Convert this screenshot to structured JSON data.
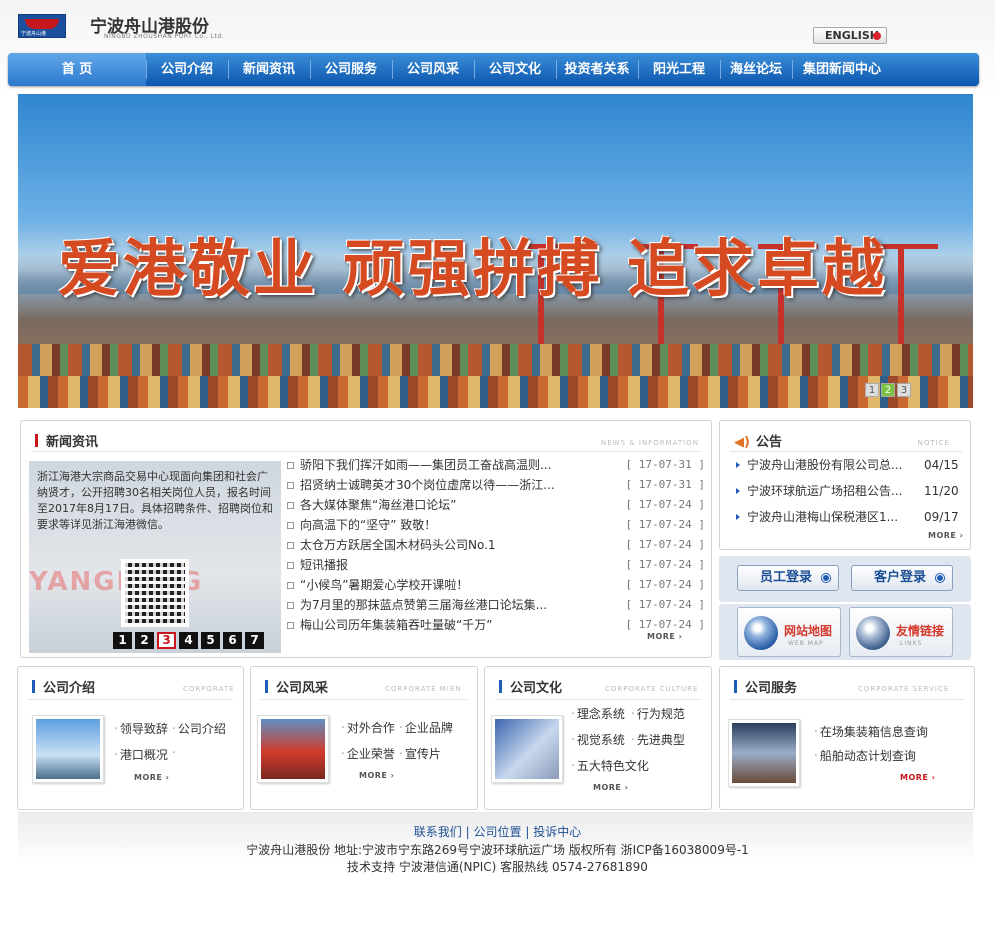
{
  "header": {
    "brand": "宁波舟山港股份",
    "brand_en": "NINGBO ZHOUSHAN PORT Co., Ltd.",
    "logo_text": "宁波舟山港",
    "english_label": "ENGLISH"
  },
  "nav": {
    "items": [
      "首 页",
      "公司介绍",
      "新闻资讯",
      "公司服务",
      "公司风采",
      "公司文化",
      "投资者关系",
      "阳光工程",
      "海丝论坛",
      "集团新闻中心"
    ]
  },
  "banner": {
    "slogan": "爱港敬业 顽强拼搏 追求卓越",
    "slides": [
      "1",
      "2",
      "3"
    ],
    "active_slide": 2
  },
  "news": {
    "title": "新闻资讯",
    "title_en": "NEWS & INFORMATION",
    "image_caption": "浙江海港大宗商品交易中心现面向集团和社会广纳贤才，公开招聘30名相关岗位人员，报名时间至2017年8月17日。具体招聘条件、招聘岗位和要求等详见浙江海港微信。",
    "image_watermark": "YANGMING",
    "pager": [
      "1",
      "2",
      "3",
      "4",
      "5",
      "6",
      "7"
    ],
    "active_page": 3,
    "items": [
      {
        "title": "骄阳下我们挥汗如雨——集团员工奋战高温则...",
        "date": "[ 17-07-31 ]"
      },
      {
        "title": "招贤纳士诚聘英才30个岗位虚席以待——浙江...",
        "date": "[ 17-07-31 ]"
      },
      {
        "title": "各大媒体聚焦“海丝港口论坛”",
        "date": "[ 17-07-24 ]"
      },
      {
        "title": "向高温下的“坚守” 致敬！",
        "date": "[ 17-07-24 ]"
      },
      {
        "title": "太仓万方跃居全国木材码头公司No.1",
        "date": "[ 17-07-24 ]"
      },
      {
        "title": "短讯播报",
        "date": "[ 17-07-24 ]"
      },
      {
        "title": "“小候鸟”暑期爱心学校开课啦！",
        "date": "[ 17-07-24 ]"
      },
      {
        "title": "为7月里的那抹蓝点赞第三届海丝港口论坛集...",
        "date": "[ 17-07-24 ]"
      },
      {
        "title": "梅山公司历年集装箱吞吐量破“千万”",
        "date": "[ 17-07-24 ]"
      }
    ],
    "more": "MORE"
  },
  "notice": {
    "title": "公告",
    "title_en": "NOTICE",
    "items": [
      {
        "title": "宁波舟山港股份有限公司总...",
        "date": "04/15"
      },
      {
        "title": "宁波环球航运广场招租公告...",
        "date": "11/20"
      },
      {
        "title": "宁波舟山港梅山保税港区1...",
        "date": "09/17"
      }
    ],
    "more": "MORE"
  },
  "login": {
    "staff": "员工登录",
    "client": "客户登录"
  },
  "links": {
    "sitemap": "网站地图",
    "sitemap_en": "WEB MAP",
    "friend": "友情链接",
    "friend_en": "LINKS"
  },
  "bottom": {
    "intro": {
      "title": "公司介绍",
      "title_en": "CORPORATE",
      "links": [
        "领导致辞",
        "公司介绍",
        "港口概况",
        ""
      ],
      "more": "MORE"
    },
    "mien": {
      "title": "公司风采",
      "title_en": "CORPORATE MIEN",
      "links": [
        "对外合作",
        "企业品牌",
        "企业荣誉",
        "宣传片"
      ],
      "more": "MORE"
    },
    "culture": {
      "title": "公司文化",
      "title_en": "CORPORATE CULTURE",
      "links": [
        "理念系统",
        "行为规范",
        "视觉系统",
        "先进典型",
        "五大特色文化"
      ],
      "more": "MORE"
    },
    "service": {
      "title": "公司服务",
      "title_en": "CORPORATE SERVICE",
      "links": [
        "在场集装箱信息查询",
        "船舶动态计划查询"
      ],
      "more": "MORE"
    }
  },
  "footer": {
    "link1": "联系我们",
    "link2": "公司位置",
    "link3": "投诉中心",
    "sep": "|",
    "line1": "宁波舟山港股份 地址:宁波市宁东路269号宁波环球航运广场 版权所有 浙ICP备16038009号-1",
    "line2": "技术支持 宁波港信通(NPIC) 客服热线 0574-27681890"
  },
  "colors": {
    "nav_blue": "#0c56ae",
    "accent_red": "#c8161d",
    "link_blue": "#1d4f94"
  }
}
